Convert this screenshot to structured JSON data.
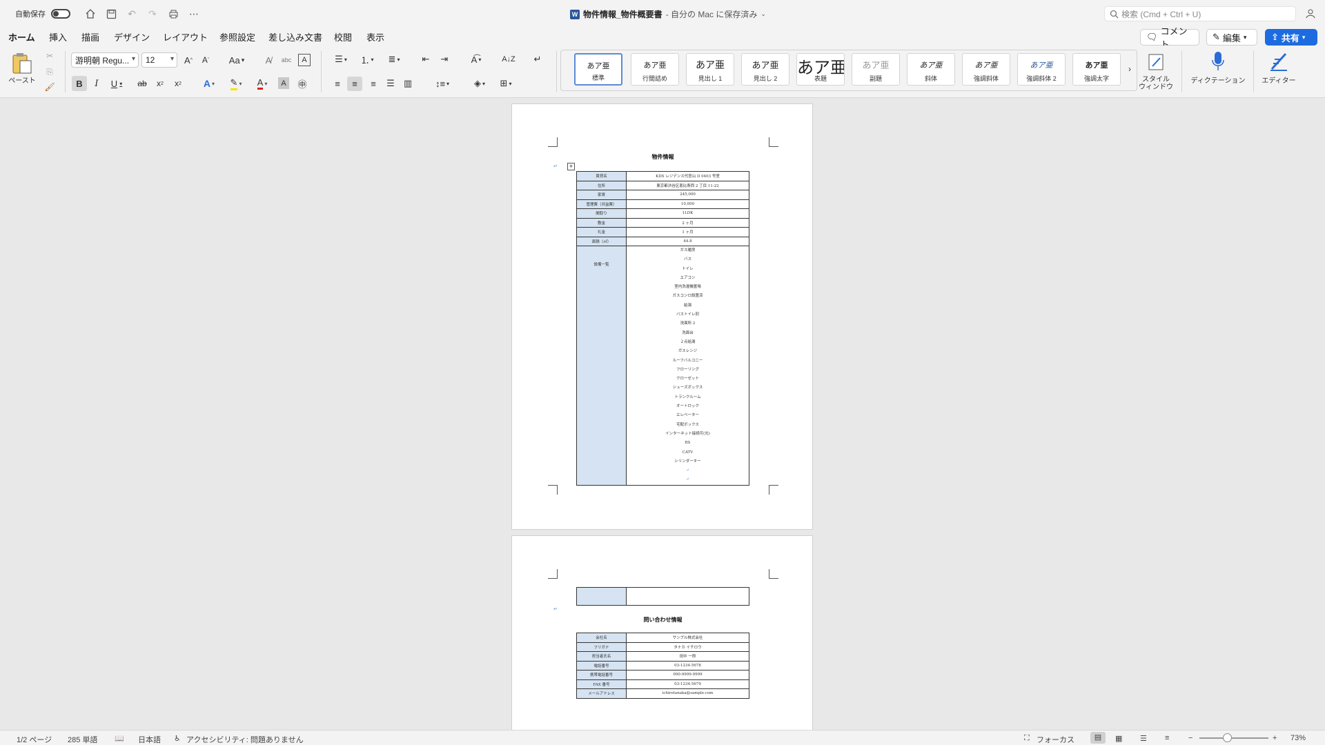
{
  "titlebar": {
    "autosave_label": "自動保存",
    "doc_title": "物件情報_物件概要書",
    "save_status": "- 自分の Mac に保存済み",
    "search_placeholder": "検索 (Cmd + Ctrl + U)"
  },
  "tabs": [
    "ホーム",
    "挿入",
    "描画",
    "デザイン",
    "レイアウト",
    "参照設定",
    "差し込み文書",
    "校閲",
    "表示"
  ],
  "active_tab": "ホーム",
  "buttons": {
    "comment": "コメント",
    "edit": "編集",
    "share": "共有"
  },
  "ribbon": {
    "paste_label": "ペースト",
    "font_name": "游明朝 Regu...",
    "font_size": "12",
    "change_case": "Aa",
    "styles": [
      {
        "sample": "あア亜",
        "label": "標準"
      },
      {
        "sample": "あア亜",
        "label": "行間詰め"
      },
      {
        "sample": "あア亜",
        "label": "見出し 1"
      },
      {
        "sample": "あア亜",
        "label": "見出し 2"
      },
      {
        "sample": "あア亜",
        "label": "表題"
      },
      {
        "sample": "あア亜",
        "label": "副題"
      },
      {
        "sample": "あア亜",
        "label": "斜体"
      },
      {
        "sample": "あア亜",
        "label": "強調斜体"
      },
      {
        "sample": "あア亜",
        "label": "強調斜体 2"
      },
      {
        "sample": "あア亜",
        "label": "強調太字"
      }
    ],
    "style_window_label": "スタイル\nウィンドウ",
    "dictation_label": "ディクテーション",
    "editor_label": "エディター"
  },
  "document": {
    "page1_heading": "物件情報",
    "property_rows": [
      {
        "k": "賃貸名",
        "v": "KDX レジデンス代官山 II 0403 号室"
      },
      {
        "k": "住所",
        "v": "東京都渋谷区恵比寿西 2 丁目 11-22"
      },
      {
        "k": "家賃",
        "v": "245,000"
      },
      {
        "k": "管理費（共益費）",
        "v": "10,000"
      },
      {
        "k": "間取り",
        "v": "1LDK"
      },
      {
        "k": "敷金",
        "v": "2 ヶ月"
      },
      {
        "k": "礼金",
        "v": "1 ヶ月"
      },
      {
        "k": "面積（㎡）",
        "v": "44.8"
      }
    ],
    "equipment_label": "設備一覧",
    "equipment": [
      "ガス暖房",
      "バス",
      "トイレ",
      "エアコン",
      "室内洗濯機置場",
      "ガスコンロ設置済",
      "給湯",
      "バストイレ別",
      "洗面所 2",
      "洗面台",
      "２点給湯",
      "ガスレンジ",
      "ルーフバルコニー",
      "フローリング",
      "クローゼット",
      "シューズボックス",
      "トランクルーム",
      "オートロック",
      "エレベーター",
      "宅配ボックス",
      "インターネット接続可(光)",
      "BS",
      "CATV",
      "シリンダーキー"
    ],
    "page2_heading": "問い合わせ情報",
    "contact_rows": [
      {
        "k": "会社名",
        "v": "サンプル株式会社"
      },
      {
        "k": "フリガナ",
        "v": "タナカ イチロウ"
      },
      {
        "k": "担当者氏名",
        "v": "田中 一郎"
      },
      {
        "k": "電話番号",
        "v": "03-1234-5678"
      },
      {
        "k": "携帯電話番号",
        "v": "090-9999-9999"
      },
      {
        "k": "FAX 番号",
        "v": "03-1234-5679"
      },
      {
        "k": "メールアドレス",
        "v": "ichirotanaka@sample.com"
      }
    ]
  },
  "status": {
    "page": "1/2 ページ",
    "words": "285 単語",
    "language": "日本語",
    "accessibility": "アクセシビリティ: 問題ありません",
    "focus": "フォーカス",
    "zoom": "73%",
    "zoom_level": 0.4
  }
}
